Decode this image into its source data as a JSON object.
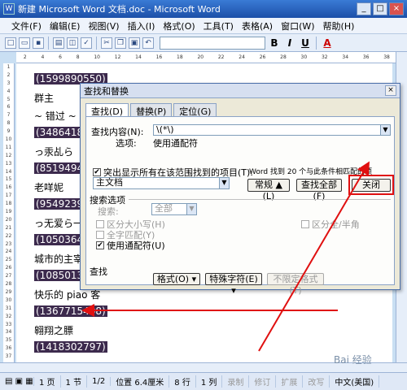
{
  "window": {
    "title": "新建 Microsoft Word 文档.doc - Microsoft Word",
    "buttons": [
      "_",
      "□",
      "×"
    ]
  },
  "menu": [
    "文件(F)",
    "编辑(E)",
    "视图(V)",
    "插入(I)",
    "格式(O)",
    "工具(T)",
    "表格(A)",
    "窗口(W)",
    "帮助(H)"
  ],
  "toolbar": {
    "bold": "B",
    "italic": "I",
    "underline": "U",
    "fontcolor": "A"
  },
  "ruler_ticks": [
    "2",
    "4",
    "6",
    "8",
    "10",
    "12",
    "14",
    "16",
    "18",
    "20",
    "22",
    "24",
    "26",
    "28",
    "30",
    "32",
    "34",
    "36",
    "38"
  ],
  "vruler_ticks": [
    "1",
    "2",
    "3",
    "4",
    "5",
    "6",
    "7",
    "8",
    "9",
    "10",
    "11",
    "12",
    "13",
    "14",
    "15",
    "16",
    "17",
    "18",
    "19",
    "20",
    "21",
    "22",
    "23",
    "24",
    "25",
    "26",
    "27",
    "28",
    "29",
    "30",
    "31",
    "32",
    "33",
    "34",
    "35",
    "36",
    "37"
  ],
  "document": {
    "lines": [
      {
        "text": "(1599890550)",
        "hl": true
      },
      {
        "text": "群主",
        "hl": false
      },
      {
        "text": "~ 错过 ~",
        "hl": false
      },
      {
        "text": "(348641863)",
        "hl": true
      },
      {
        "text": "っ汞乩ら",
        "hl": false
      },
      {
        "text": "(851949423)",
        "hl": true
      },
      {
        "text": "老咩妮",
        "hl": false
      },
      {
        "text": "(954923990)",
        "hl": true
      },
      {
        "text": "っ无爱ら一",
        "hl": false
      },
      {
        "text": "(105036480",
        "hl": true
      },
      {
        "text": "城市的主宰",
        "hl": false
      },
      {
        "text": "(108501387",
        "hl": true
      },
      {
        "text": "快乐的 piao 客",
        "hl": false
      },
      {
        "text": "(1367715408)",
        "hl": true
      },
      {
        "text": "翱翔之膘",
        "hl": false
      },
      {
        "text": "(1418302797)",
        "hl": true
      }
    ]
  },
  "dialog": {
    "title": "查找和替换",
    "close_x": "×",
    "tabs": [
      "查找(D)",
      "替换(P)",
      "定位(G)"
    ],
    "find_label": "查找内容(N):",
    "find_value": "\\(*\\)",
    "options_label": "选项:",
    "options_value": "使用通配符",
    "highlight_checkbox": "突出显示所有在该范围找到的项目(T):",
    "highlight_checked": "✔",
    "range_value": "主文档",
    "result_text": "Word 找到 20 个与此条件相匹配的项",
    "btn_normal": "常规 ▲ (L)",
    "btn_findall": "查找全部(F)",
    "btn_close": "关闭",
    "search_options_title": "搜索选项",
    "search_label": "搜索:",
    "search_value": "全部",
    "case_label": "区分大小写(H)",
    "whole_word_label": "全字匹配(Y)",
    "wildcard_label": "使用通配符(U)",
    "wildcard_checked": "✔",
    "fullhalf_label": "区分全/半角",
    "find_section": "查找",
    "format_btn": "格式(O) ▾",
    "special_btn": "特殊字符(E) ▾",
    "noformat_btn": "不限定格式(T)"
  },
  "status": {
    "page": "1 页",
    "section": "1 节",
    "page_of": "1/2",
    "position": "位置 6.4厘米",
    "line": "8 行",
    "col": "1 列",
    "rec": "录制",
    "trk": "修订",
    "ext": "扩展",
    "ovr": "改写",
    "lang": "中文(美国)"
  },
  "watermark": "Bai 经验"
}
